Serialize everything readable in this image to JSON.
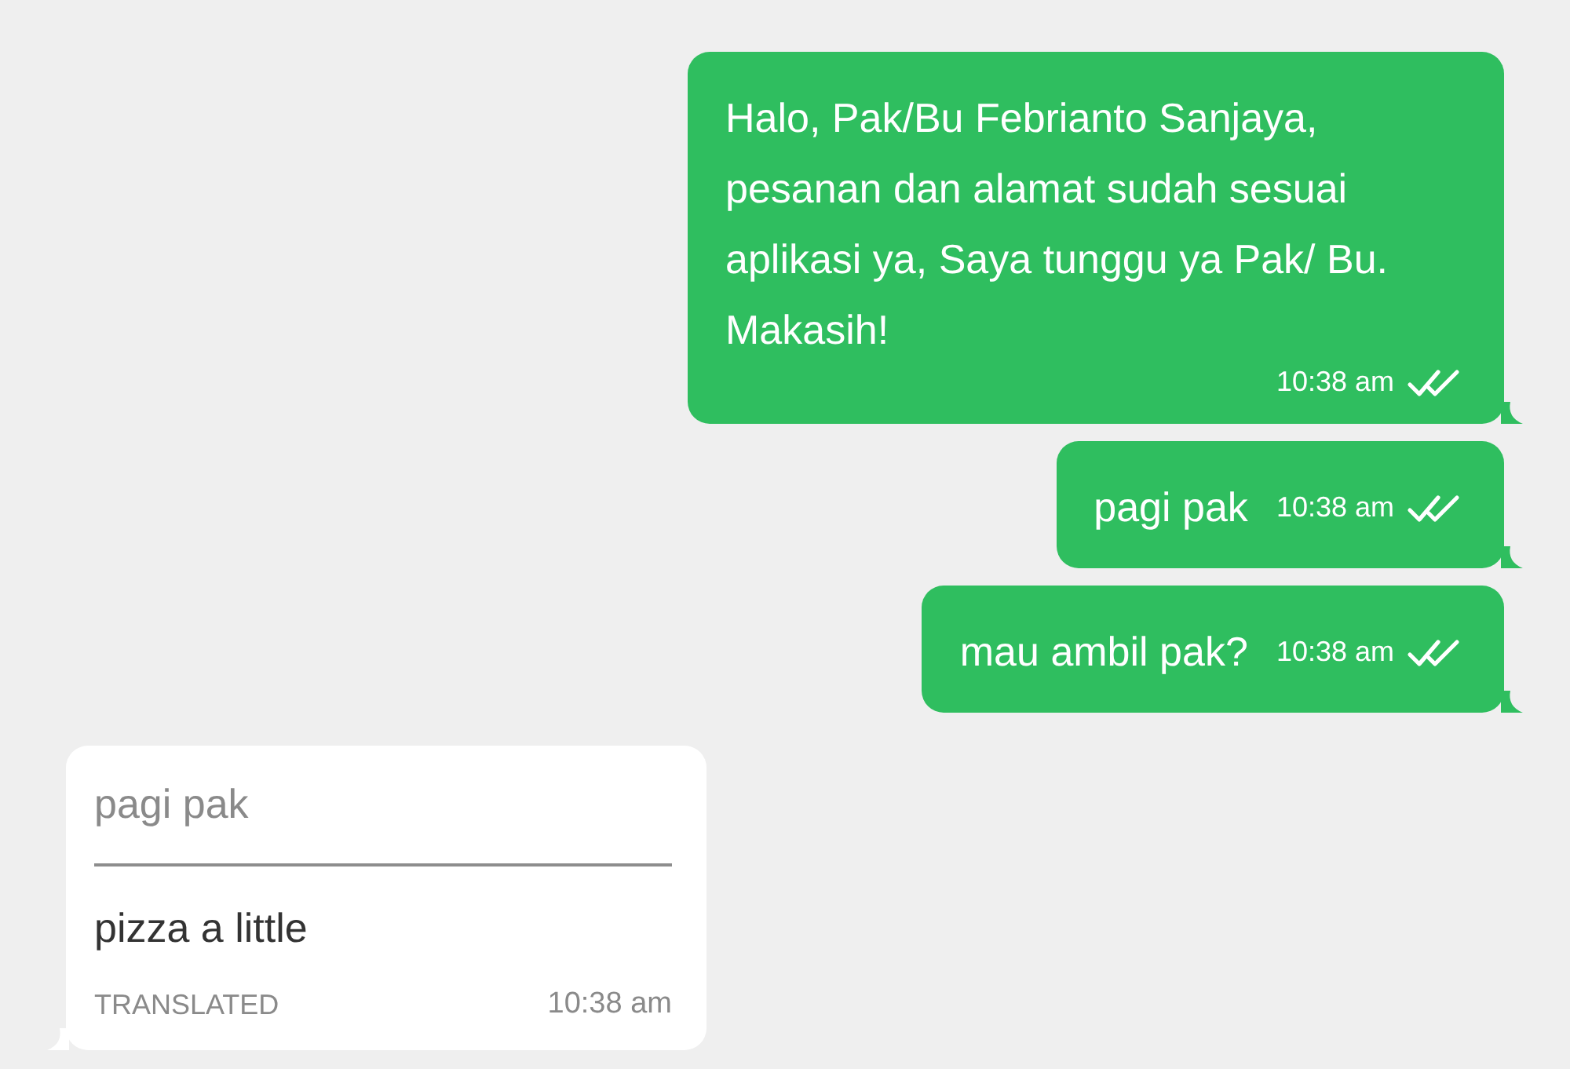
{
  "messages": [
    {
      "kind": "outgoing",
      "text": "Halo, Pak/Bu Febrianto Sanjaya, pesanan dan alamat sudah sesuai aplikasi ya, Saya tunggu ya Pak/ Bu. Makasih!",
      "time": "10:38 am",
      "read": true
    },
    {
      "kind": "outgoing",
      "text": "pagi pak",
      "time": "10:38 am",
      "read": true
    },
    {
      "kind": "outgoing",
      "text": "mau ambil pak?",
      "time": "10:38 am",
      "read": true
    },
    {
      "kind": "incoming",
      "original": "pagi pak",
      "text": "pizza a little",
      "label": "TRANSLATED",
      "time": "10:38 am"
    }
  ]
}
